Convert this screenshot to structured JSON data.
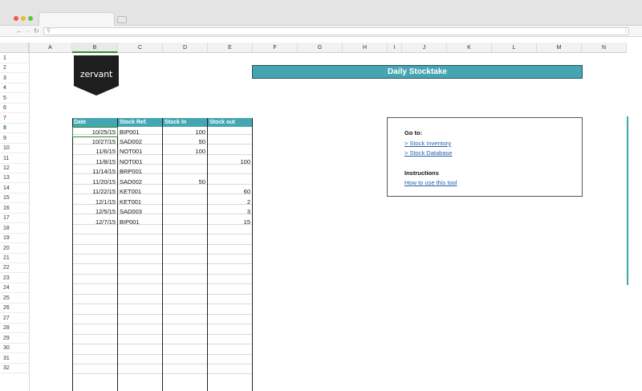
{
  "browser": {
    "menu_glyph": "⋮",
    "search_glyph": "⚲"
  },
  "sheet": {
    "columns": [
      "A",
      "B",
      "C",
      "D",
      "E",
      "F",
      "G",
      "H",
      "I",
      "J",
      "K",
      "L",
      "M",
      "N"
    ],
    "rows": [
      "1",
      "2",
      "3",
      "4",
      "5",
      "6",
      "7",
      "8",
      "9",
      "10",
      "11",
      "12",
      "13",
      "14",
      "15",
      "16",
      "17",
      "18",
      "19",
      "20",
      "21",
      "22",
      "23",
      "24",
      "25",
      "26",
      "27",
      "28",
      "29",
      "30",
      "31",
      "32"
    ],
    "selected_column": "B",
    "selected_row": "8"
  },
  "logo": {
    "text": "zervant"
  },
  "title": "Daily Stocktake",
  "table": {
    "headers": [
      "Date",
      "Stock Ref.",
      "Stock In",
      "Stock out"
    ],
    "rows": [
      [
        "10/25/15",
        "BIP001",
        "100",
        ""
      ],
      [
        "10/27/15",
        "SAD002",
        "50",
        ""
      ],
      [
        "11/6/15",
        "NOT001",
        "100",
        ""
      ],
      [
        "11/8/15",
        "NOT001",
        "",
        "100"
      ],
      [
        "11/14/15",
        "BRP001",
        "",
        ""
      ],
      [
        "11/20/15",
        "SAD002",
        "50",
        ""
      ],
      [
        "11/22/15",
        "KET001",
        "",
        "60"
      ],
      [
        "12/1/15",
        "KET001",
        "",
        "2"
      ],
      [
        "12/5/15",
        "SAD003",
        "",
        "3"
      ],
      [
        "12/7/15",
        "BIP001",
        "",
        "15"
      ]
    ]
  },
  "goto": {
    "title": "Go to:",
    "links": [
      "> Stock Inventory",
      "> Stock Database"
    ],
    "instructions_title": "Instructions",
    "instructions_link": "How to use this tool"
  },
  "colors": {
    "accent": "#45a6b3",
    "logo_bg": "#1e1e1e",
    "link": "#1f5fae",
    "selection": "#2f8a2f"
  }
}
